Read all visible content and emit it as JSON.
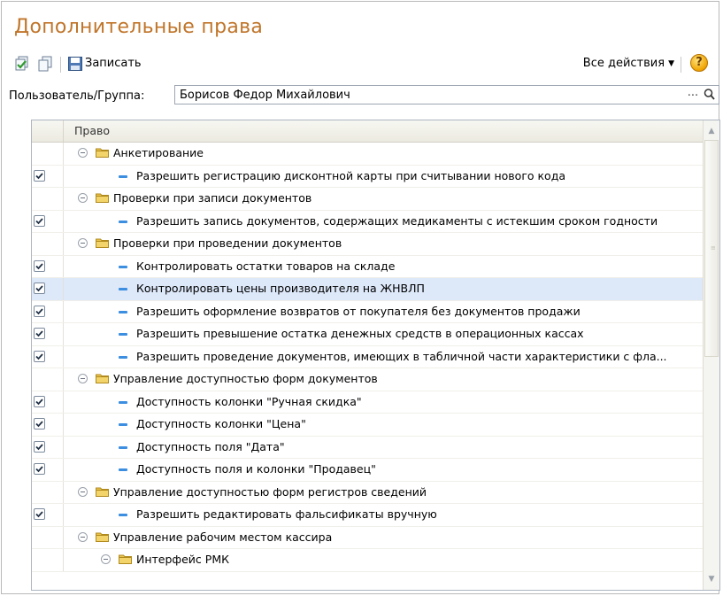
{
  "title": "Дополнительные права",
  "toolbar": {
    "save_label": "Записать",
    "all_actions_label": "Все действия",
    "all_actions_caret": "▼",
    "help_label": "?"
  },
  "user_group": {
    "label": "Пользователь/Группа:",
    "value": "Борисов Федор Михайлович",
    "dots": "..."
  },
  "table": {
    "column_header": "Право",
    "rows": [
      {
        "label": "Анкетирование",
        "type": "group",
        "level": 0,
        "checked": false,
        "selected": false
      },
      {
        "label": "Разрешить регистрацию дисконтной карты при считывании нового кода",
        "type": "item",
        "level": 1,
        "checked": true,
        "selected": false
      },
      {
        "label": "Проверки при записи документов",
        "type": "group",
        "level": 0,
        "checked": false,
        "selected": false
      },
      {
        "label": "Разрешить запись документов, содержащих медикаменты с истекшим сроком годности",
        "type": "item",
        "level": 1,
        "checked": true,
        "selected": false
      },
      {
        "label": "Проверки при проведении документов",
        "type": "group",
        "level": 0,
        "checked": false,
        "selected": false
      },
      {
        "label": "Контролировать остатки товаров на складе",
        "type": "item",
        "level": 1,
        "checked": true,
        "selected": false
      },
      {
        "label": "Контролировать цены производителя на ЖНВЛП",
        "type": "item",
        "level": 1,
        "checked": true,
        "selected": true
      },
      {
        "label": "Разрешить оформление возвратов от покупателя без документов продажи",
        "type": "item",
        "level": 1,
        "checked": true,
        "selected": false
      },
      {
        "label": "Разрешить превышение остатка денежных средств в операционных кассах",
        "type": "item",
        "level": 1,
        "checked": true,
        "selected": false
      },
      {
        "label": "Разрешить проведение документов, имеющих в табличной части характеристики с фла...",
        "type": "item",
        "level": 1,
        "checked": true,
        "selected": false
      },
      {
        "label": "Управление доступностью форм документов",
        "type": "group",
        "level": 0,
        "checked": false,
        "selected": false
      },
      {
        "label": "Доступность колонки \"Ручная скидка\"",
        "type": "item",
        "level": 1,
        "checked": true,
        "selected": false
      },
      {
        "label": "Доступность колонки \"Цена\"",
        "type": "item",
        "level": 1,
        "checked": true,
        "selected": false
      },
      {
        "label": "Доступность поля \"Дата\"",
        "type": "item",
        "level": 1,
        "checked": true,
        "selected": false
      },
      {
        "label": "Доступность поля и колонки \"Продавец\"",
        "type": "item",
        "level": 1,
        "checked": true,
        "selected": false
      },
      {
        "label": "Управление доступностью форм регистров сведений",
        "type": "group",
        "level": 0,
        "checked": false,
        "selected": false
      },
      {
        "label": "Разрешить редактировать фальсификаты вручную",
        "type": "item",
        "level": 1,
        "checked": true,
        "selected": false
      },
      {
        "label": "Управление рабочим местом кассира",
        "type": "group",
        "level": 0,
        "checked": false,
        "selected": false
      },
      {
        "label": "Интерфейс РМК",
        "type": "group",
        "level": 1,
        "checked": false,
        "selected": false
      }
    ]
  },
  "colors": {
    "title": "#c0752a",
    "selected_row": "#dde8f9",
    "item_dash": "#3c8ee0",
    "folder": "#e8c350"
  },
  "icons": [
    "post-and-close-icon",
    "copy-icon",
    "save-icon",
    "help-icon",
    "search-icon",
    "collapse-icon",
    "folder-icon",
    "checkbox-icon"
  ]
}
